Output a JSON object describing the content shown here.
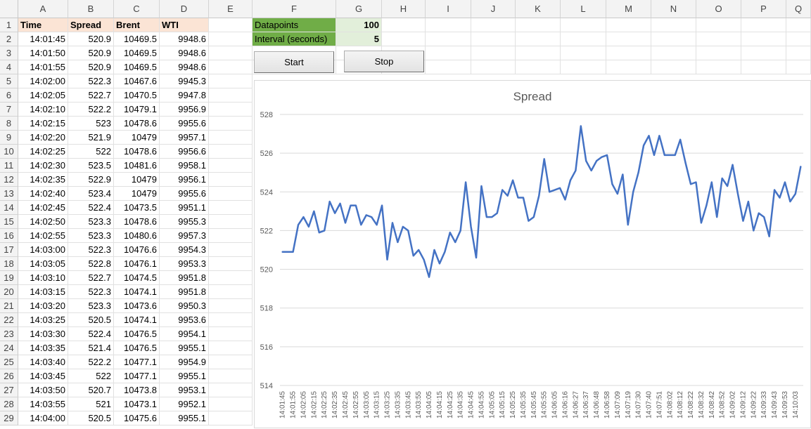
{
  "sheet": {
    "columns": [
      "A",
      "B",
      "C",
      "D",
      "E",
      "F",
      "G",
      "H",
      "I",
      "J",
      "K",
      "L",
      "M",
      "N",
      "O",
      "P",
      "Q"
    ],
    "rows": [
      "1",
      "2",
      "3",
      "4",
      "5",
      "6",
      "7",
      "8",
      "9",
      "10",
      "11",
      "12",
      "13",
      "14",
      "15",
      "16",
      "17",
      "18",
      "19",
      "20",
      "21",
      "22",
      "23",
      "24",
      "25",
      "26",
      "27",
      "28",
      "29"
    ],
    "headers": [
      "Time",
      "Spread",
      "Brent",
      "WTI"
    ],
    "data": [
      [
        "14:01:45",
        "520.9",
        "10469.5",
        "9948.6"
      ],
      [
        "14:01:50",
        "520.9",
        "10469.5",
        "9948.6"
      ],
      [
        "14:01:55",
        "520.9",
        "10469.5",
        "9948.6"
      ],
      [
        "14:02:00",
        "522.3",
        "10467.6",
        "9945.3"
      ],
      [
        "14:02:05",
        "522.7",
        "10470.5",
        "9947.8"
      ],
      [
        "14:02:10",
        "522.2",
        "10479.1",
        "9956.9"
      ],
      [
        "14:02:15",
        "523",
        "10478.6",
        "9955.6"
      ],
      [
        "14:02:20",
        "521.9",
        "10479",
        "9957.1"
      ],
      [
        "14:02:25",
        "522",
        "10478.6",
        "9956.6"
      ],
      [
        "14:02:30",
        "523.5",
        "10481.6",
        "9958.1"
      ],
      [
        "14:02:35",
        "522.9",
        "10479",
        "9956.1"
      ],
      [
        "14:02:40",
        "523.4",
        "10479",
        "9955.6"
      ],
      [
        "14:02:45",
        "522.4",
        "10473.5",
        "9951.1"
      ],
      [
        "14:02:50",
        "523.3",
        "10478.6",
        "9955.3"
      ],
      [
        "14:02:55",
        "523.3",
        "10480.6",
        "9957.3"
      ],
      [
        "14:03:00",
        "522.3",
        "10476.6",
        "9954.3"
      ],
      [
        "14:03:05",
        "522.8",
        "10476.1",
        "9953.3"
      ],
      [
        "14:03:10",
        "522.7",
        "10474.5",
        "9951.8"
      ],
      [
        "14:03:15",
        "522.3",
        "10474.1",
        "9951.8"
      ],
      [
        "14:03:20",
        "523.3",
        "10473.6",
        "9950.3"
      ],
      [
        "14:03:25",
        "520.5",
        "10474.1",
        "9953.6"
      ],
      [
        "14:03:30",
        "522.4",
        "10476.5",
        "9954.1"
      ],
      [
        "14:03:35",
        "521.4",
        "10476.5",
        "9955.1"
      ],
      [
        "14:03:40",
        "522.2",
        "10477.1",
        "9954.9"
      ],
      [
        "14:03:45",
        "522",
        "10477.1",
        "9955.1"
      ],
      [
        "14:03:50",
        "520.7",
        "10473.8",
        "9953.1"
      ],
      [
        "14:03:55",
        "521",
        "10473.1",
        "9952.1"
      ],
      [
        "14:04:00",
        "520.5",
        "10475.6",
        "9955.1"
      ]
    ],
    "params": [
      {
        "label": "Datapoints",
        "value": "100"
      },
      {
        "label": "Interval (seconds)",
        "value": "5"
      }
    ]
  },
  "buttons": {
    "start": "Start",
    "stop": "Stop"
  },
  "colors": {
    "header_fill": "#fbe4d5",
    "param_label_fill": "#70ad47",
    "param_value_fill": "#e2efda",
    "series_line": "#4472c4"
  },
  "chart_data": {
    "type": "line",
    "title": "Spread",
    "xlabel": "",
    "ylabel": "",
    "ylim": [
      514,
      528
    ],
    "yticks": [
      514,
      516,
      518,
      520,
      522,
      524,
      526,
      528
    ],
    "grid": true,
    "xtick_labels": [
      "14:01:45",
      "14:01:55",
      "14:02:05",
      "14:02:15",
      "14:02:25",
      "14:02:35",
      "14:02:45",
      "14:02:55",
      "14:03:05",
      "14:03:15",
      "14:03:25",
      "14:03:35",
      "14:03:45",
      "14:03:55",
      "14:04:05",
      "14:04:15",
      "14:04:25",
      "14:04:35",
      "14:04:45",
      "14:04:55",
      "14:05:05",
      "14:05:15",
      "14:05:25",
      "14:05:35",
      "14:05:45",
      "14:05:55",
      "14:06:05",
      "14:06:16",
      "14:06:27",
      "14:06:37",
      "14:06:48",
      "14:06:58",
      "14:07:09",
      "14:07:19",
      "14:07:30",
      "14:07:40",
      "14:07:51",
      "14:08:02",
      "14:08:12",
      "14:08:22",
      "14:08:32",
      "14:08:42",
      "14:08:52",
      "14:09:02",
      "14:09:12",
      "14:09:22",
      "14:09:33",
      "14:09:43",
      "14:09:53",
      "14:10:03"
    ],
    "series": [
      {
        "values": [
          520.9,
          520.9,
          520.9,
          522.3,
          522.7,
          522.2,
          523,
          521.9,
          522,
          523.5,
          522.9,
          523.4,
          522.4,
          523.3,
          523.3,
          522.3,
          522.8,
          522.7,
          522.3,
          523.3,
          520.5,
          522.4,
          521.4,
          522.2,
          522,
          520.7,
          521,
          520.5,
          519.6,
          521,
          520.3,
          520.9,
          521.9,
          521.4,
          522,
          524.5,
          522.2,
          520.6,
          524.3,
          522.7,
          522.7,
          522.9,
          524.1,
          523.8,
          524.6,
          523.7,
          523.7,
          522.5,
          522.7,
          523.8,
          525.7,
          524,
          524.1,
          524.2,
          523.6,
          524.6,
          525.1,
          527.4,
          525.6,
          525.1,
          525.6,
          525.8,
          525.9,
          524.4,
          523.9,
          524.9,
          522.3,
          524,
          525,
          526.4,
          526.9,
          525.9,
          526.9,
          525.9,
          525.9,
          525.9,
          526.7,
          525.5,
          524.4,
          524.5,
          522.4,
          523.3,
          524.5,
          522.7,
          524.7,
          524.3,
          525.4,
          523.9,
          522.5,
          523.5,
          522,
          522.9,
          522.7,
          521.7,
          524.1,
          523.7,
          524.5,
          523.5,
          523.9,
          525.3
        ]
      }
    ]
  }
}
